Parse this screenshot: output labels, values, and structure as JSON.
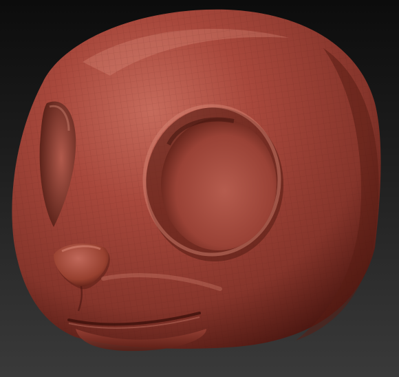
{
  "viewport": {
    "background_top": "#0c0c0c",
    "background_bottom": "#3a3a3a"
  },
  "model": {
    "subject": "sculpted-creature-head",
    "material_color": "#a8483c",
    "material_shadow": "#4a1610",
    "material_highlight": "#e69a88",
    "wireframe_visible": true,
    "parts": [
      "head",
      "left-eye-socket",
      "right-eye-socket",
      "nose",
      "mouth"
    ]
  }
}
